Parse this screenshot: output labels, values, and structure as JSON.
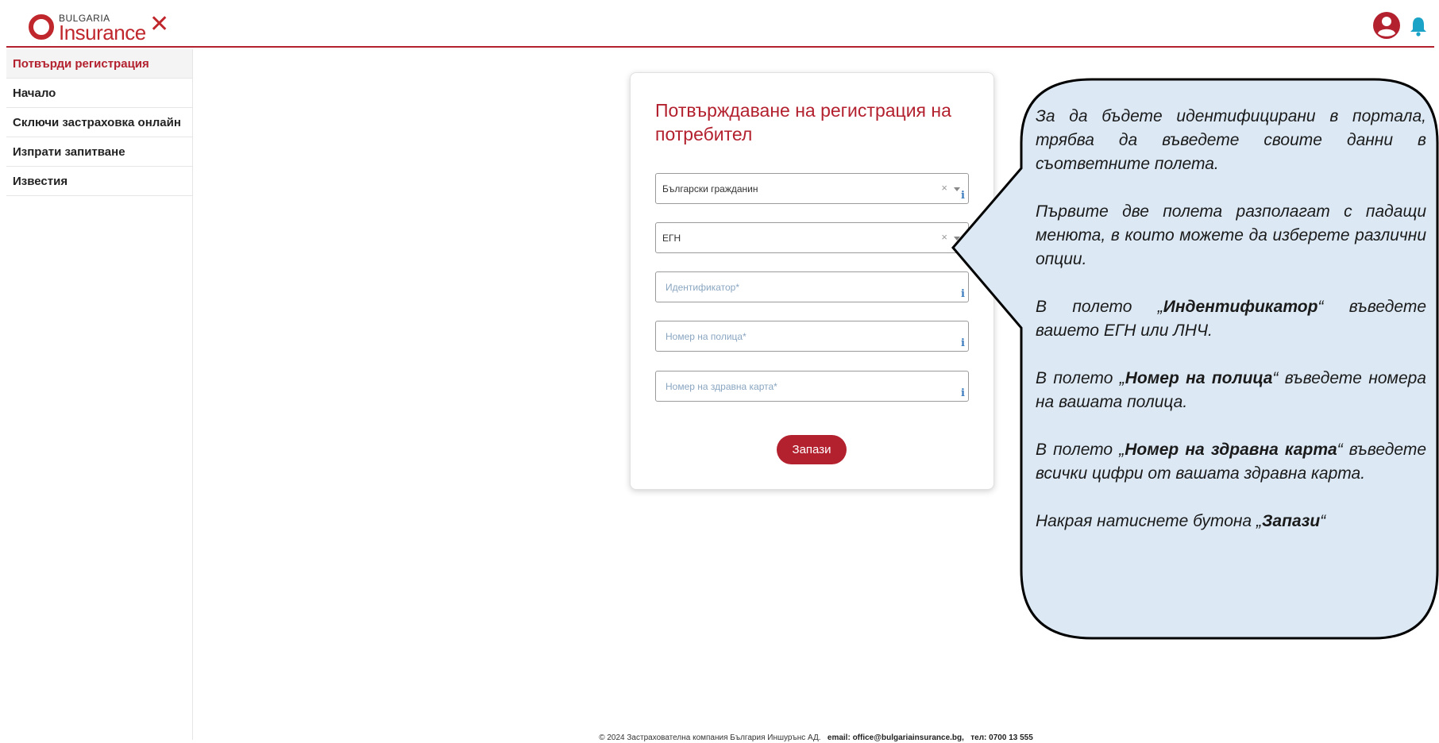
{
  "header": {
    "logo_small": "BULGARIA",
    "logo_big": "Insurance",
    "close_glyph": "✕",
    "icons": [
      "user-circle-icon",
      "bell-icon"
    ],
    "accent_color": "#b3212f",
    "bell_color": "#1aa3c6"
  },
  "sidebar": {
    "items": [
      {
        "label": "Потвърди регистрация",
        "active": true
      },
      {
        "label": "Начало"
      },
      {
        "label": "Сключи застраховка онлайн"
      },
      {
        "label": "Изпрати запитване"
      },
      {
        "label": "Известия"
      }
    ]
  },
  "form": {
    "title": "Потвърждаване на регистрация на потребител",
    "citizenship_value": "Български гражданин",
    "id_type_value": "ЕГН",
    "identifier_placeholder": "Идентификатор*",
    "policy_placeholder": "Номер на полица*",
    "health_card_placeholder": "Номер на здравна карта*",
    "clear_glyph": "×",
    "info_glyph": "i",
    "save_label": "Запази"
  },
  "callout": {
    "p1": "За да бъдете идентифицирани в портала, трябва да въведете своите данни в съответните полета.",
    "p2": "Първите две полета разполагат с падащи менюта, в които можете да изберете различни опции.",
    "p3_pre": "В полето „",
    "p3_bold": "Индентификатор",
    "p3_post": "“ въведете вашето ЕГН или ЛНЧ.",
    "p4_pre": "В полето „",
    "p4_bold": "Номер на полица",
    "p4_post": "“ въведете номера на вашата полица.",
    "p5_pre": "В полето „",
    "p5_bold": "Номер на здравна карта",
    "p5_post": "“ въведете всички цифри от вашата здравна карта.",
    "p6_pre": "Накрая натиснете бутона „",
    "p6_bold": "Запази",
    "p6_post": "“",
    "bg_color": "#dce9f5"
  },
  "footer": {
    "copyright": "© 2024 Застрахователна компания България Иншурънс АД.",
    "email": "email: office@bulgariainsurance.bg,",
    "phone": "тел: 0700 13 555"
  }
}
